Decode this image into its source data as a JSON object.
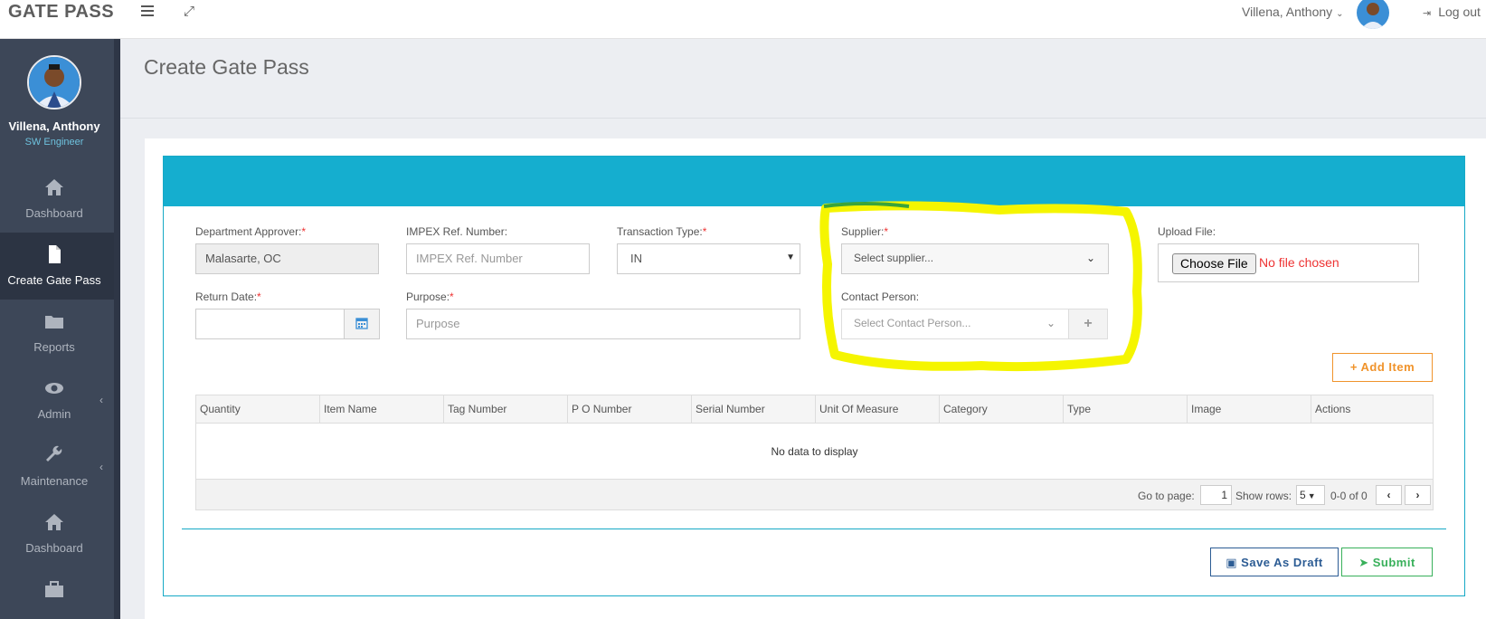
{
  "app": {
    "brand": "GATE PASS"
  },
  "topbar": {
    "user_name": "Villena, Anthony",
    "user_caret": "⌄",
    "logout_label": "Log out"
  },
  "sidebar": {
    "profile": {
      "name": "Villena, Anthony",
      "role": "SW Engineer"
    },
    "items": [
      {
        "label": "Dashboard",
        "icon": "home-icon",
        "active": false
      },
      {
        "label": "Create Gate Pass",
        "icon": "file-icon",
        "active": true
      },
      {
        "label": "Reports",
        "icon": "folder-icon",
        "active": false
      },
      {
        "label": "Admin",
        "icon": "eye-icon",
        "active": false,
        "expandable": true
      },
      {
        "label": "Maintenance",
        "icon": "wrench-icon",
        "active": false,
        "expandable": true
      },
      {
        "label": "Dashboard",
        "icon": "home-icon",
        "active": false
      },
      {
        "label": "",
        "icon": "briefcase-icon",
        "active": false
      }
    ]
  },
  "page": {
    "title": "Create Gate Pass"
  },
  "form": {
    "department_approver": {
      "label": "Department Approver:",
      "required": "*",
      "value": "Malasarte, OC"
    },
    "impex_ref": {
      "label": "IMPEX Ref. Number:",
      "placeholder": "IMPEX Ref. Number"
    },
    "transaction_type": {
      "label": "Transaction Type:",
      "required": "*",
      "value": "IN"
    },
    "supplier": {
      "label": "Supplier:",
      "required": "*",
      "placeholder": "Select supplier..."
    },
    "upload_file": {
      "label": "Upload File:",
      "button": "Choose File",
      "status": "No file chosen"
    },
    "return_date": {
      "label": "Return Date:",
      "required": "*",
      "value": ""
    },
    "purpose": {
      "label": "Purpose:",
      "required": "*",
      "placeholder": "Purpose"
    },
    "contact_person": {
      "label": "Contact Person:",
      "placeholder": "Select Contact Person..."
    }
  },
  "buttons": {
    "add_item": "Add Item",
    "save_draft": "Save As Draft",
    "submit": "Submit"
  },
  "grid": {
    "columns": [
      "Quantity",
      "Item Name",
      "Tag Number",
      "P O Number",
      "Serial Number",
      "Unit Of Measure",
      "Category",
      "Type",
      "Image",
      "Actions"
    ],
    "empty_text": "No data to display",
    "pager": {
      "go_to_label": "Go to page:",
      "page_value": "1",
      "show_rows_label": "Show rows:",
      "rows_value": "5",
      "range_text": "0-0 of 0"
    }
  },
  "colors": {
    "accent": "#15aecf",
    "sidebar_bg": "#3d4758",
    "add_item": "#f0932b",
    "save_draft": "#2c5c94",
    "submit": "#38b05a",
    "highlight": "#f5f500",
    "required": "#ee3333"
  }
}
